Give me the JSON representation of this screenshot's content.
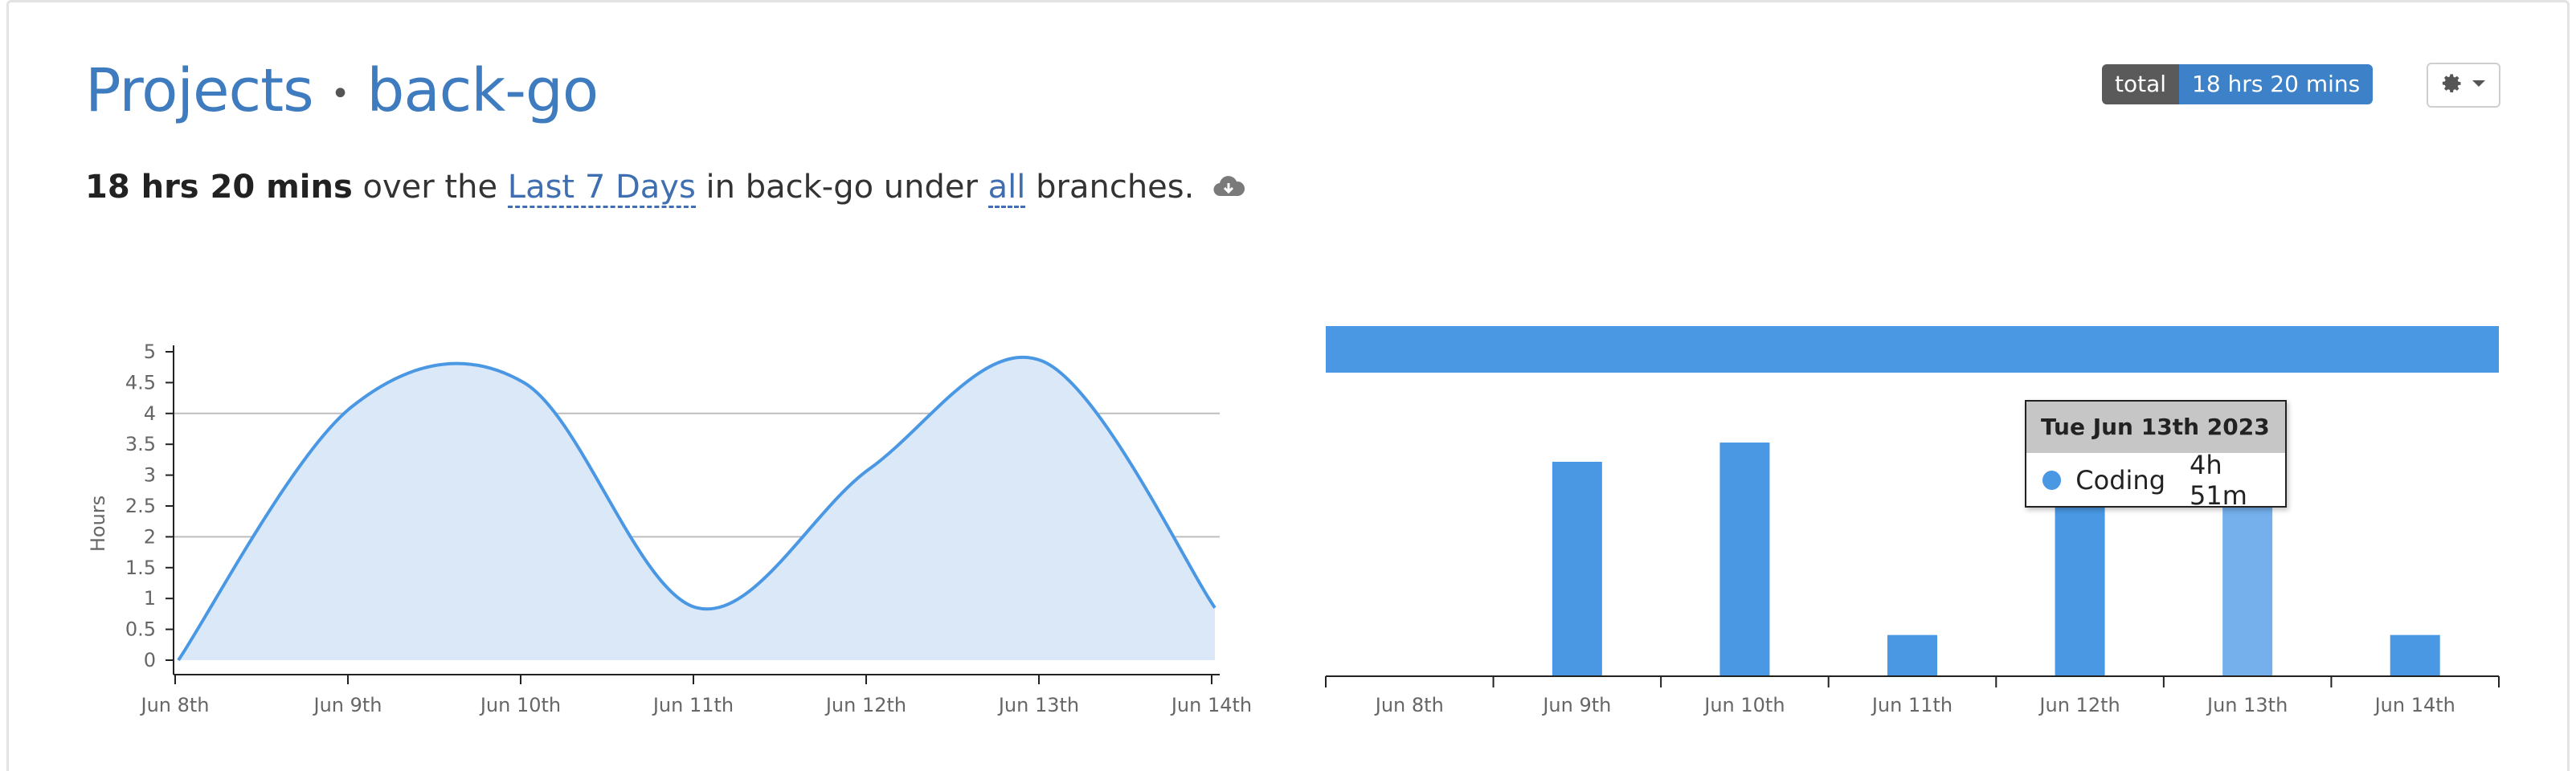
{
  "header": {
    "title_section": "Projects",
    "title_separator": "•",
    "title_project": "back-go",
    "total_label": "total",
    "total_value": "18 hrs 20 mins"
  },
  "summary": {
    "duration": "18 hrs 20 mins",
    "text_over": "over the",
    "range_link": "Last 7 Days",
    "text_in": "in back-go under",
    "branches_link": "all",
    "text_end": "branches."
  },
  "icons": {
    "gear": "gear-icon",
    "caret": "caret-down-icon",
    "download": "cloud-download-icon"
  },
  "colors": {
    "accent": "#4a98e4",
    "area_fill": "#dae8f8",
    "highlight_bar": "#75b0ec"
  },
  "tooltip": {
    "title": "Tue Jun 13th 2023",
    "series": "Coding",
    "value": "4h 51m"
  },
  "chart_data": [
    {
      "type": "area",
      "ylabel": "Hours",
      "categories": [
        "Jun 8th",
        "Jun 9th",
        "Jun 10th",
        "Jun 11th",
        "Jun 12th",
        "Jun 13th",
        "Jun 14th"
      ],
      "values": [
        0,
        4.1,
        4.5,
        0.85,
        3.1,
        4.85,
        0.85
      ],
      "ylim": [
        0,
        5
      ],
      "yticks": [
        "0",
        "0.5",
        "1",
        "1.5",
        "2",
        "2.5",
        "3",
        "3.5",
        "4",
        "4.5",
        "5"
      ],
      "gridlines": [
        2,
        4
      ]
    },
    {
      "type": "bar",
      "series": [
        {
          "name": "Coding",
          "values": [
            0,
            3.9,
            4.25,
            0.75,
            3.1,
            4.85,
            0.75
          ]
        }
      ],
      "categories": [
        "Jun 8th",
        "Jun 9th",
        "Jun 10th",
        "Jun 11th",
        "Jun 12th",
        "Jun 13th",
        "Jun 14th"
      ],
      "highlighted": "Jun 13th",
      "legend_bar": true
    }
  ]
}
